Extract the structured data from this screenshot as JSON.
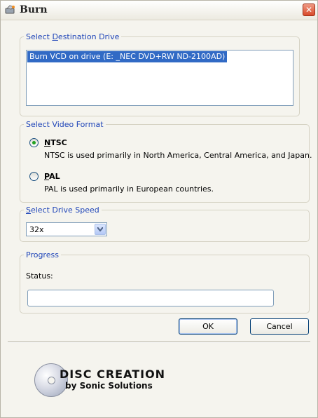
{
  "window": {
    "title": "Burn",
    "close_glyph": "✕"
  },
  "destination": {
    "legend_prefix": "Select ",
    "legend_mnemonic": "D",
    "legend_suffix": "estination Drive",
    "items": [
      "Burn VCD on drive (E: _NEC  DVD+RW ND-2100AD)"
    ],
    "selected_index": 0
  },
  "video_format": {
    "legend": "Select Video Format",
    "ntsc": {
      "mnemonic": "N",
      "rest": "TSC",
      "desc": "NTSC is used primarily in North America, Central America, and Japan.",
      "checked": true
    },
    "pal": {
      "mnemonic": "P",
      "rest": "AL",
      "desc": "PAL is used primarily in European countries.",
      "checked": false
    }
  },
  "drive_speed": {
    "legend_mnemonic": "S",
    "legend_rest": "elect Drive Speed",
    "value": "32x"
  },
  "progress": {
    "legend": "Progress",
    "status_label": "Status:",
    "percent": 0
  },
  "buttons": {
    "ok": "OK",
    "cancel": "Cancel"
  },
  "logo": {
    "line1": "DISC CREATION",
    "line2": "by Sonic Solutions"
  },
  "colors": {
    "legend_text": "#1f45b8",
    "selection": "#316ac5",
    "radio_dot": "#21a121"
  }
}
